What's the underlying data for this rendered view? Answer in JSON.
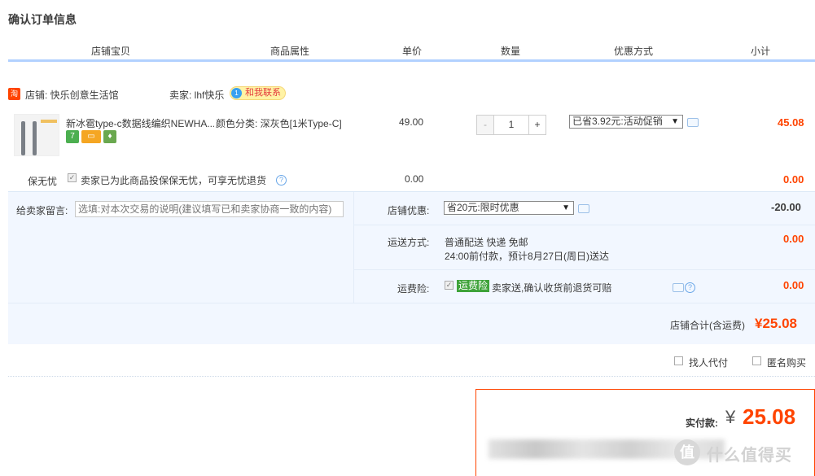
{
  "page": {
    "title": "确认订单信息"
  },
  "columns": [
    "店铺宝贝",
    "商品属性",
    "单价",
    "数量",
    "优惠方式",
    "小计"
  ],
  "shop": {
    "icon": "tmall-shop-icon",
    "name": "店铺: 快乐创意生活馆",
    "seller": "卖家: lhf快乐",
    "contact": "和我联系",
    "contact_dot": "1"
  },
  "item": {
    "name": "新冰雹type-c数据线编织NEWHA...",
    "badges": [
      {
        "label": "7",
        "color": "#4caf50"
      },
      {
        "label": "▭",
        "color": "#f5a623"
      },
      {
        "label": "♦",
        "color": "#6aa84f"
      }
    ],
    "attr": "颜色分类: 深灰色[1米Type-C]",
    "price": "49.00",
    "quantity": "1",
    "minus": "-",
    "plus": "+",
    "promo": "已省3.92元:活动促销",
    "subtotal": "45.08"
  },
  "insurance": {
    "label": "保无忧",
    "text": "卖家已为此商品投保保无忧，可享无忧退货",
    "price": "0.00",
    "subtotal": "0.00"
  },
  "message": {
    "label": "给卖家留言:",
    "placeholder": "选填:对本次交易的说明(建议填写已和卖家协商一致的内容)"
  },
  "shop_discount": {
    "label": "店铺优惠:",
    "selected": "省20元:限时优惠",
    "amount": "-20.00"
  },
  "shipping": {
    "label": "运送方式:",
    "method": "普通配送 快递 免邮",
    "eta": "24:00前付款，预计8月27日(周日)送达",
    "amount": "0.00"
  },
  "freight_insurance": {
    "label": "运费险:",
    "tag": "运费险",
    "text": "卖家送,确认收货前退货可赔",
    "amount": "0.00"
  },
  "shop_total": {
    "label": "店铺合计(含运费)",
    "amount": "¥25.08"
  },
  "options": {
    "proxy_pay": "找人代付",
    "anonymous": "匿名购买"
  },
  "payment": {
    "label": "实付款:",
    "currency": "¥",
    "amount": "25.08"
  },
  "watermark": {
    "logo": "值",
    "text": "什么值得买"
  },
  "colors": {
    "accent": "#ff4400",
    "header_line": "#b2d1ff",
    "panel_bg": "#f2f7ff"
  }
}
